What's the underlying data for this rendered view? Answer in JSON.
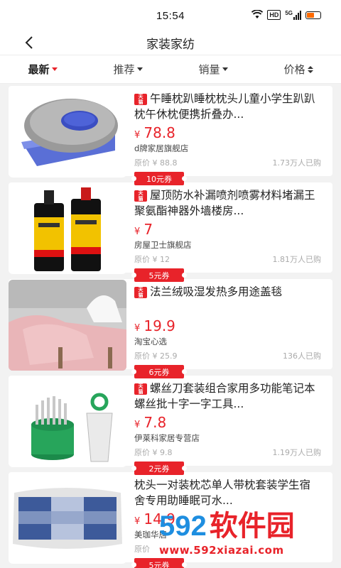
{
  "status": {
    "time": "15:54",
    "hd": "HD",
    "net": "5G"
  },
  "nav": {
    "title": "家装家纺"
  },
  "sort": [
    {
      "label": "最新",
      "indicator": "caret-red",
      "active": true
    },
    {
      "label": "推荐",
      "indicator": "caret"
    },
    {
      "label": "销量",
      "indicator": "caret"
    },
    {
      "label": "价格",
      "indicator": "up-down"
    }
  ],
  "products": [
    {
      "tmall": true,
      "tmall_text": "天猫",
      "title": "午睡枕趴睡枕枕头儿童小学生趴趴枕午休枕便携折叠办...",
      "price_symbol": "¥",
      "price": "78.8",
      "shop": "d牌家居旗舰店",
      "original_price": "原价 ¥ 88.8",
      "buyers": "1.73万人已购",
      "coupon": "10元券",
      "image": "pillow"
    },
    {
      "tmall": true,
      "tmall_text": "天猫",
      "title": "屋顶防水补漏喷剂喷雾材料堵漏王聚氨酯神器外墙楼房...",
      "price_symbol": "¥",
      "price": "7",
      "shop": "房屋卫士旗舰店",
      "original_price": "原价 ¥ 12",
      "buyers": "1.81万人已购",
      "coupon": "5元券",
      "image": "spray"
    },
    {
      "tmall": true,
      "tmall_text": "天猫",
      "title": "法兰绒吸湿发热多用途盖毯",
      "price_symbol": "¥",
      "price": "19.9",
      "shop": "淘宝心选",
      "original_price": "原价 ¥ 25.9",
      "buyers": "136人已购",
      "coupon": "6元券",
      "image": "blanket"
    },
    {
      "tmall": true,
      "tmall_text": "天猫",
      "title": "螺丝刀套装组合家用多功能笔记本螺丝批十字一字工具...",
      "price_symbol": "¥",
      "price": "7.8",
      "shop": "伊莱科家居专营店",
      "original_price": "原价 ¥ 9.8",
      "buyers": "1.19万人已购",
      "coupon": "2元券",
      "image": "screwdriver"
    },
    {
      "tmall": true,
      "tmall_text": "天猫",
      "title": "枕头一对装枕芯单人带枕套装学生宿舍专用助睡眠可水...",
      "price_symbol": "¥",
      "price": "14.9",
      "shop": "美珈华居",
      "original_price": "原价",
      "buyers": "",
      "coupon": "5元券",
      "image": "pillow2"
    }
  ],
  "watermark": {
    "logo": "592",
    "cn": "软件园",
    "url": "www.592xiazai.com"
  },
  "colors": {
    "accent": "#e8232a",
    "watermark_blue": "#1e8ee0"
  }
}
